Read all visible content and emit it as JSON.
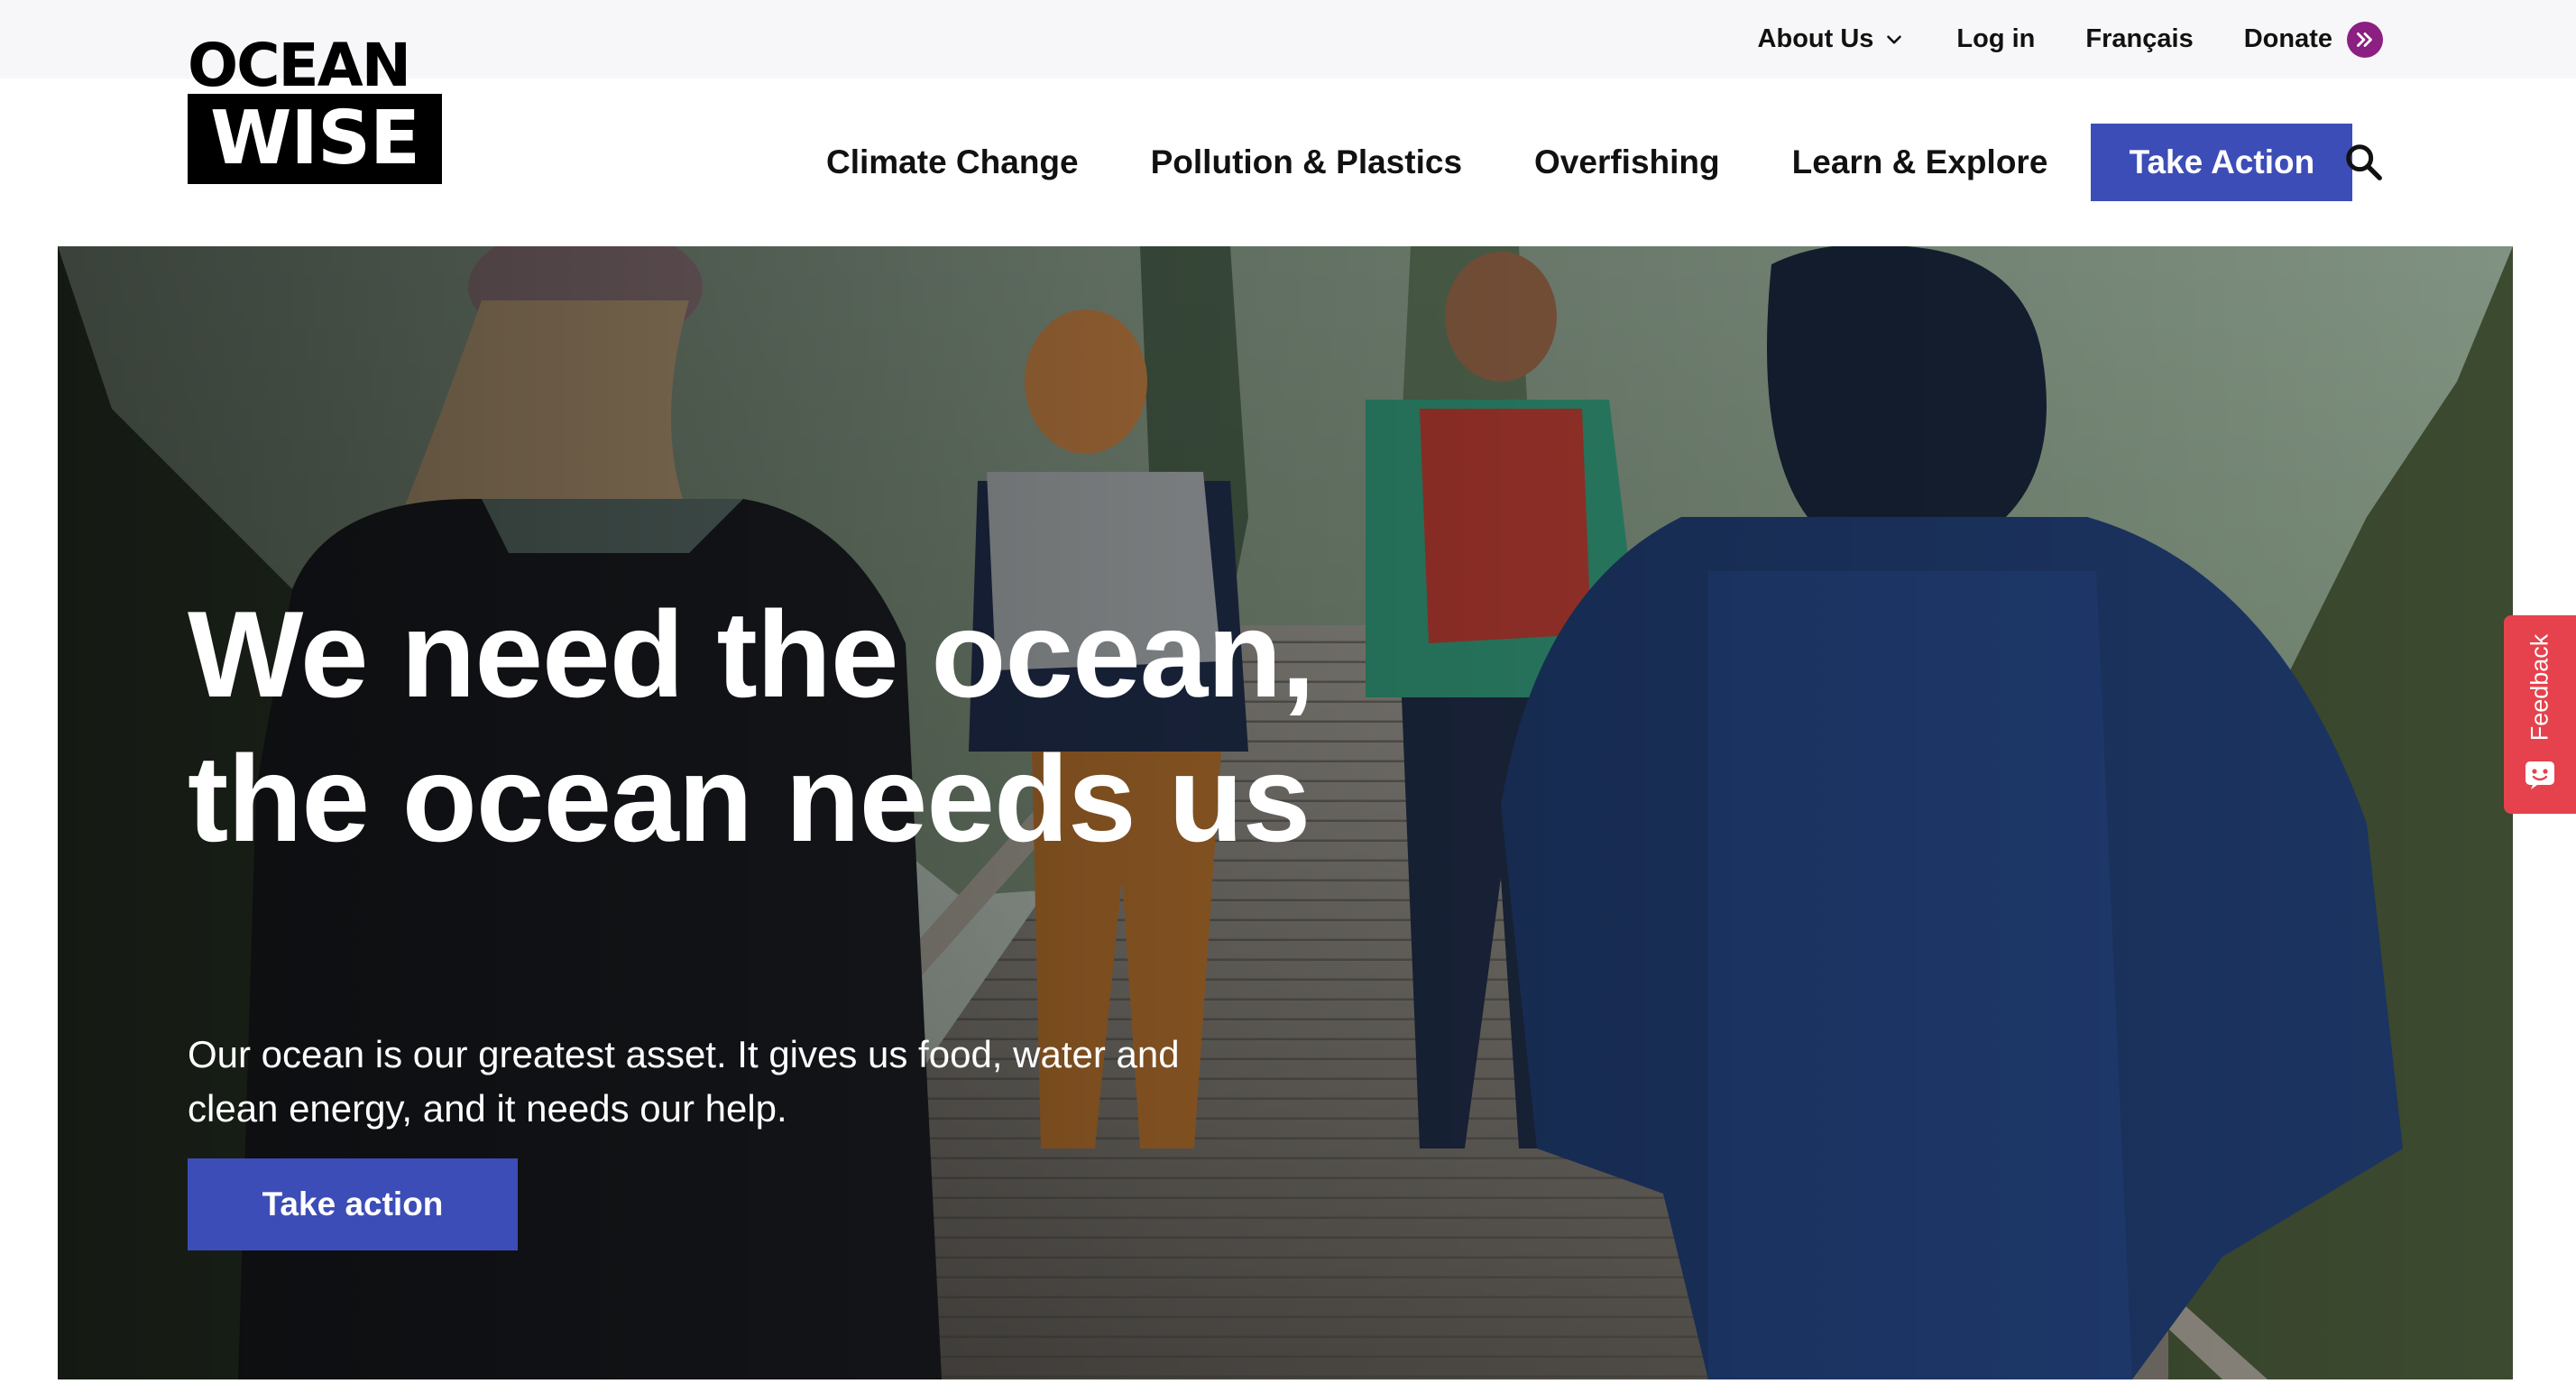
{
  "brand": {
    "logo_top": "OCEAN",
    "logo_bottom": "WISE"
  },
  "util_nav": {
    "about": "About Us",
    "login": "Log in",
    "language": "Français",
    "donate": "Donate"
  },
  "main_nav": {
    "items": [
      "Climate Change",
      "Pollution & Plastics",
      "Overfishing",
      "Learn & Explore"
    ],
    "cta": "Take Action"
  },
  "hero": {
    "title": "We need the ocean, the ocean needs us",
    "subtitle": "Our ocean is our greatest asset. It gives us food, water and clean energy, and it needs our help.",
    "cta": "Take action"
  },
  "feedback": {
    "label": "Feedback"
  },
  "icons": {
    "about_chevron": "chevron-down-icon",
    "donate": "double-chevron-right-icon",
    "search": "search-icon",
    "feedback": "smiley-icon"
  },
  "colors": {
    "primary_button": "#3d4db7",
    "donate_accent": "#8b1f82",
    "feedback_tab": "#e5424d",
    "util_bar_bg": "#f7f7f9"
  }
}
